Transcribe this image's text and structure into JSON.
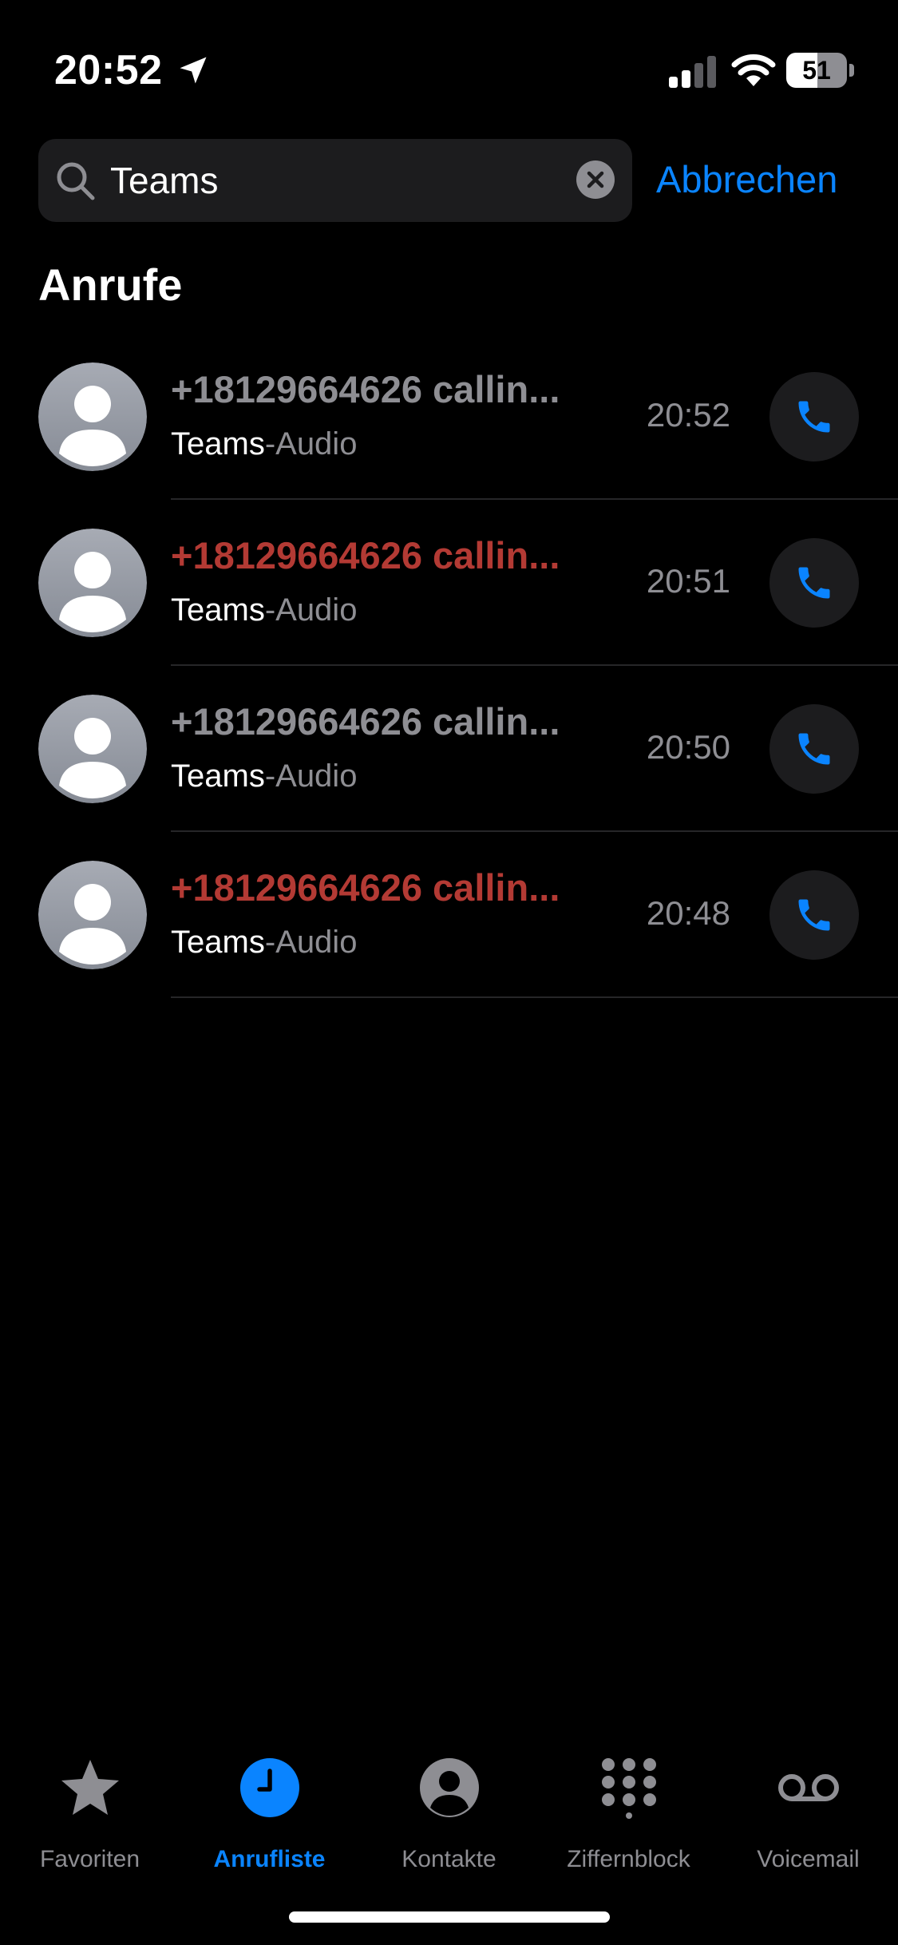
{
  "status": {
    "time": "20:52",
    "battery_level": "51",
    "battery_fraction": 0.51
  },
  "search": {
    "value": "Teams",
    "cancel_label": "Abbrechen"
  },
  "section_title": "Anrufe",
  "calls": [
    {
      "name": "+18129664626 callin...",
      "label": "Teams",
      "sub": "-Audio",
      "time": "20:52",
      "missed": false
    },
    {
      "name": "+18129664626 callin...",
      "label": "Teams",
      "sub": "-Audio",
      "time": "20:51",
      "missed": true
    },
    {
      "name": "+18129664626 callin...",
      "label": "Teams",
      "sub": "-Audio",
      "time": "20:50",
      "missed": false
    },
    {
      "name": "+18129664626 callin...",
      "label": "Teams",
      "sub": "-Audio",
      "time": "20:48",
      "missed": true
    }
  ],
  "tabs": [
    {
      "label": "Favoriten",
      "icon": "star-icon"
    },
    {
      "label": "Anrufliste",
      "icon": "clock-icon",
      "active": true
    },
    {
      "label": "Kontakte",
      "icon": "person-circle-icon"
    },
    {
      "label": "Ziffernblock",
      "icon": "keypad-icon"
    },
    {
      "label": "Voicemail",
      "icon": "voicemail-icon"
    }
  ],
  "colors": {
    "accent": "#0a84ff",
    "missed": "#b33a34",
    "secondary_text": "#8e8e93",
    "surface": "#1c1c1e"
  }
}
